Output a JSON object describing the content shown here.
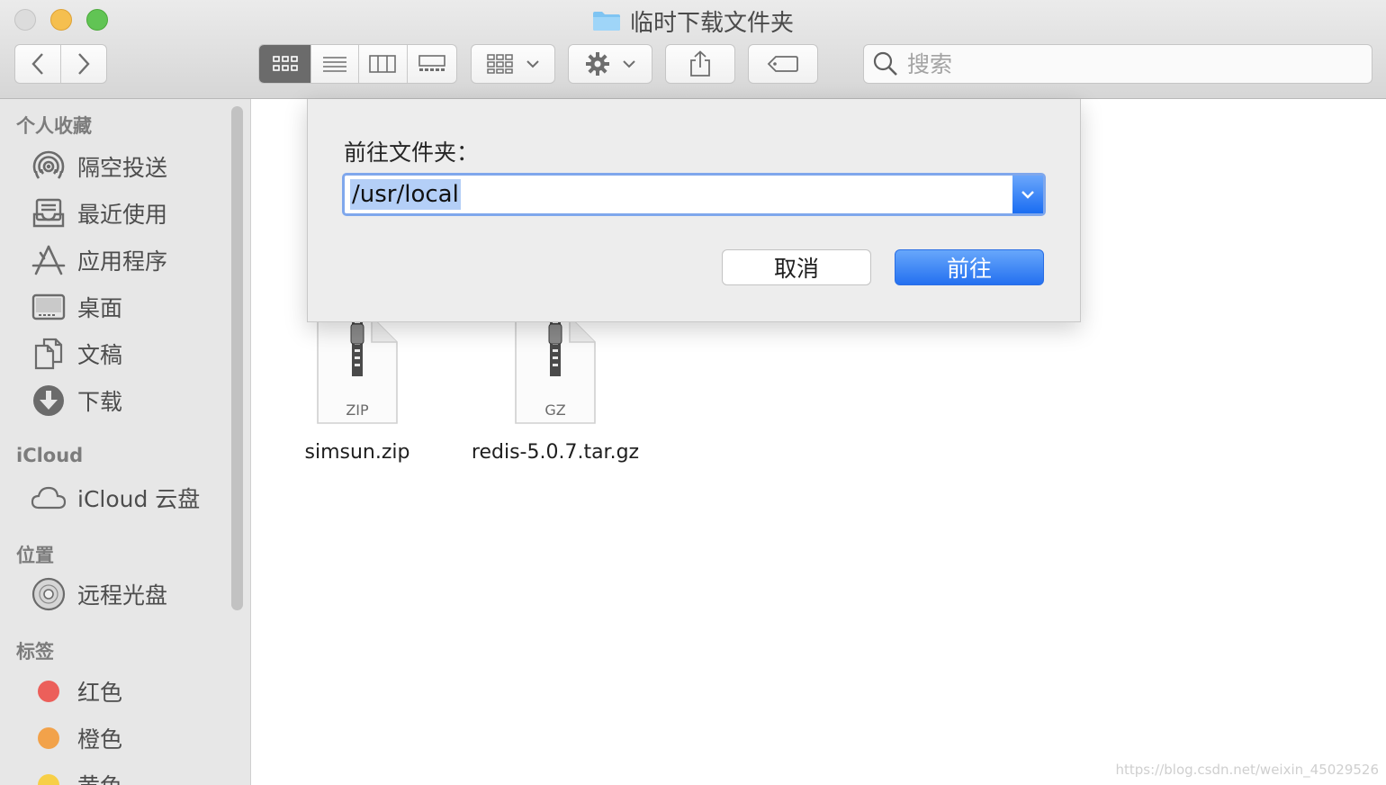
{
  "window": {
    "title": "临时下载文件夹"
  },
  "toolbar": {
    "search_placeholder": "搜索"
  },
  "sidebar": {
    "favorites_header": "个人收藏",
    "favorites": [
      {
        "label": "隔空投送",
        "icon": "airdrop-icon"
      },
      {
        "label": "最近使用",
        "icon": "recents-icon"
      },
      {
        "label": "应用程序",
        "icon": "applications-icon"
      },
      {
        "label": "桌面",
        "icon": "desktop-icon"
      },
      {
        "label": "文稿",
        "icon": "documents-icon"
      },
      {
        "label": "下载",
        "icon": "downloads-icon"
      }
    ],
    "icloud_header": "iCloud",
    "icloud": [
      {
        "label": "iCloud 云盘",
        "icon": "cloud-icon"
      }
    ],
    "locations_header": "位置",
    "locations": [
      {
        "label": "远程光盘",
        "icon": "disc-icon"
      }
    ],
    "tags_header": "标签",
    "tags": [
      {
        "label": "红色",
        "color": "#ec5f5a"
      },
      {
        "label": "橙色",
        "color": "#f2a24a"
      },
      {
        "label": "黄色",
        "color": "#f7cf47"
      }
    ]
  },
  "files": [
    {
      "name": "simsun.zip",
      "type": "ZIP"
    },
    {
      "name": "redis-5.0.7.tar.gz",
      "type": "GZ"
    }
  ],
  "dialog": {
    "title": "前往文件夹：",
    "path_value": "/usr/local",
    "cancel_label": "取消",
    "go_label": "前往"
  },
  "watermark": "https://blog.csdn.net/weixin_45029526"
}
